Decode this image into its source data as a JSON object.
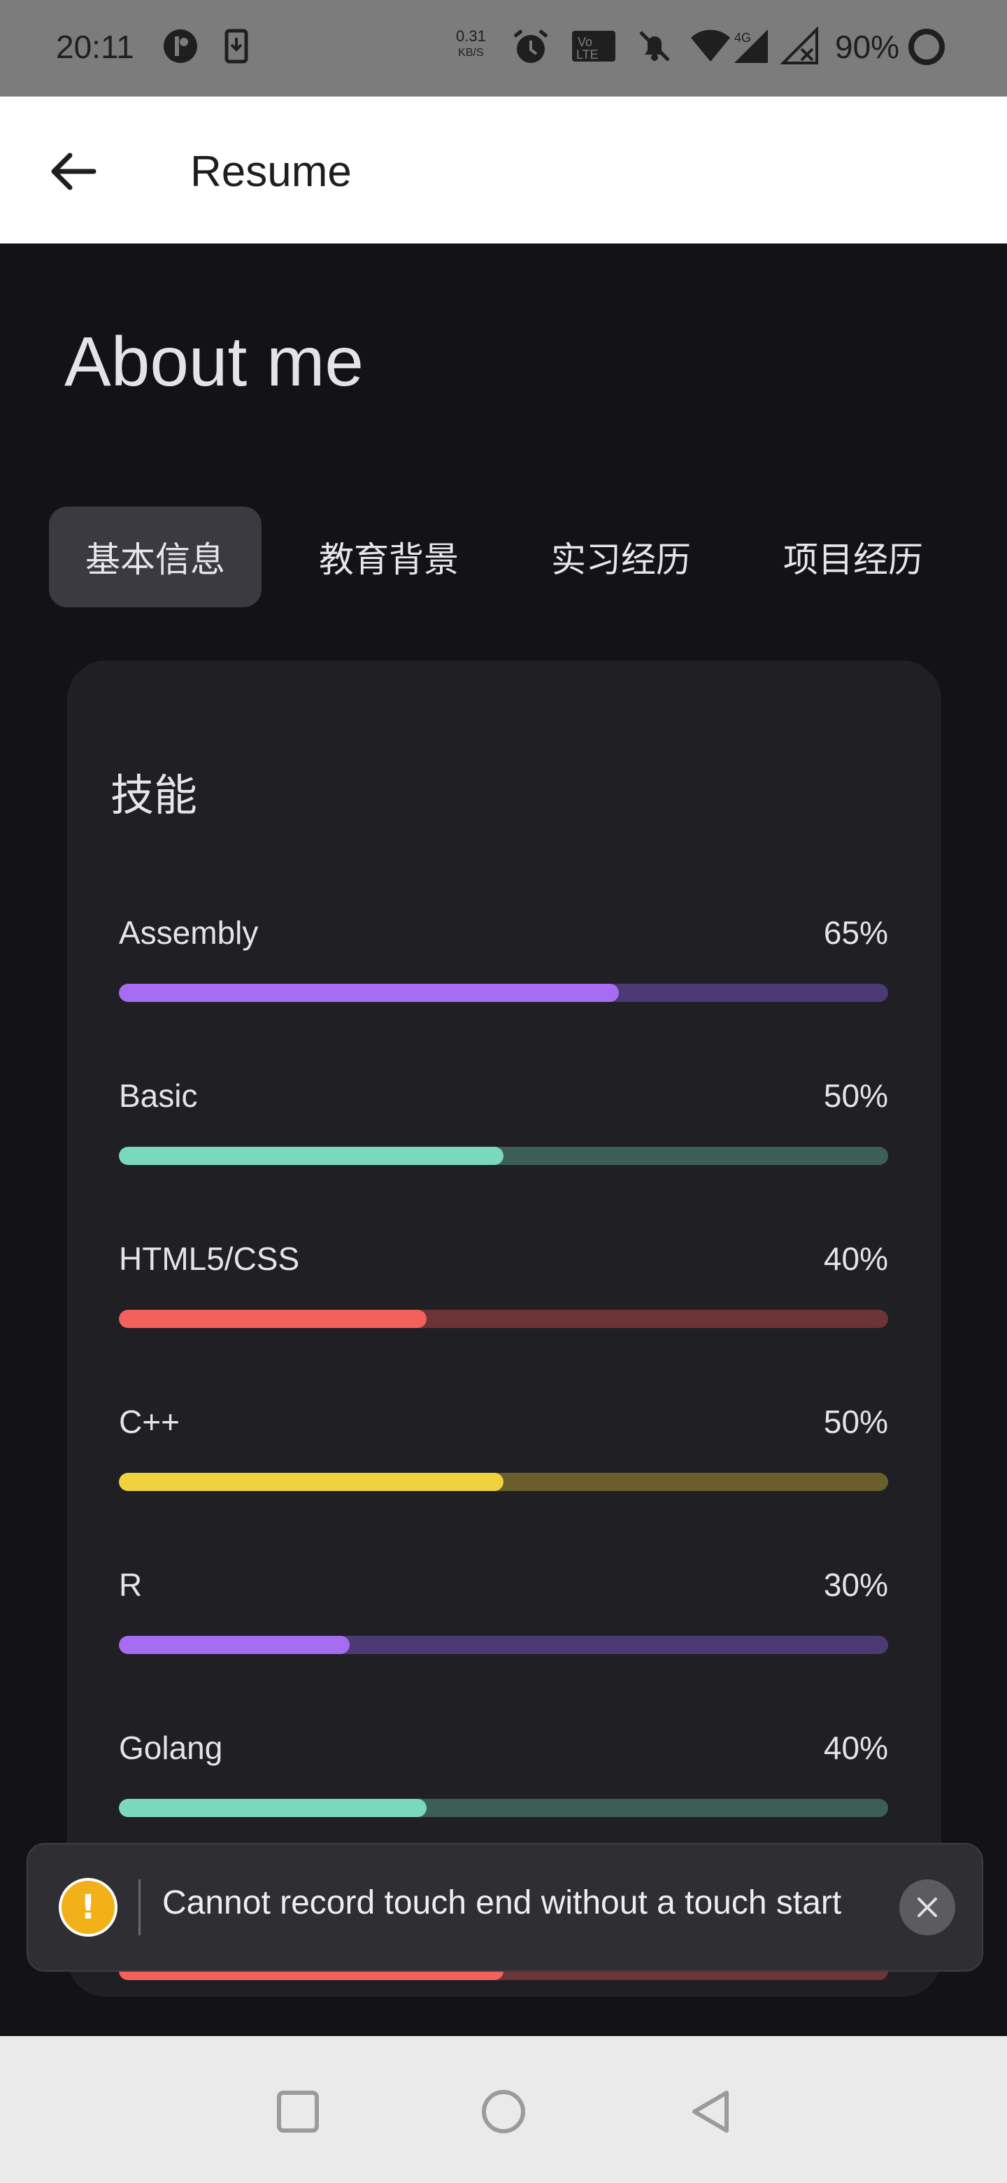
{
  "status_bar": {
    "time": "20:11",
    "net_speed_value": "0.31",
    "net_speed_unit": "KB/S",
    "battery": "90%",
    "icons": [
      "app-icon",
      "download-icon",
      "alarm-icon",
      "volte-icon",
      "mute-icon",
      "wifi-icon",
      "signal-4g-icon",
      "no-signal-icon",
      "battery-ring-icon"
    ]
  },
  "appbar": {
    "title": "Resume",
    "back_icon": "arrow-left-icon"
  },
  "heading": "About me",
  "tabs": [
    {
      "label": "基本信息",
      "active": true
    },
    {
      "label": "教育背景",
      "active": false
    },
    {
      "label": "实习经历",
      "active": false
    },
    {
      "label": "项目经历",
      "active": false
    }
  ],
  "card": {
    "title": "技能",
    "skills": [
      {
        "name": "Assembly",
        "pct": "65%",
        "value": 0.65,
        "color": "#a66cf2",
        "track": "#4b3a73"
      },
      {
        "name": "Basic",
        "pct": "50%",
        "value": 0.5,
        "color": "#7ad9bb",
        "track": "#3b5e55"
      },
      {
        "name": "HTML5/CSS",
        "pct": "40%",
        "value": 0.4,
        "color": "#f2625b",
        "track": "#6b3437"
      },
      {
        "name": "C++",
        "pct": "50%",
        "value": 0.5,
        "color": "#f1d23d",
        "track": "#6a5e2a"
      },
      {
        "name": "R",
        "pct": "30%",
        "value": 0.3,
        "color": "#a66cf2",
        "track": "#4b3a73"
      },
      {
        "name": "Golang",
        "pct": "40%",
        "value": 0.4,
        "color": "#7ad9bb",
        "track": "#3b5e55"
      },
      {
        "name": "",
        "pct": "",
        "value": 0.5,
        "color": "#f2625b",
        "track": "#6b3437"
      }
    ]
  },
  "toast": {
    "icon": "warning-icon",
    "message": "Cannot record touch end without a touch start",
    "close_icon": "close-icon"
  },
  "navbar": {
    "icons": [
      "recents-square-icon",
      "home-circle-icon",
      "back-triangle-icon"
    ]
  }
}
